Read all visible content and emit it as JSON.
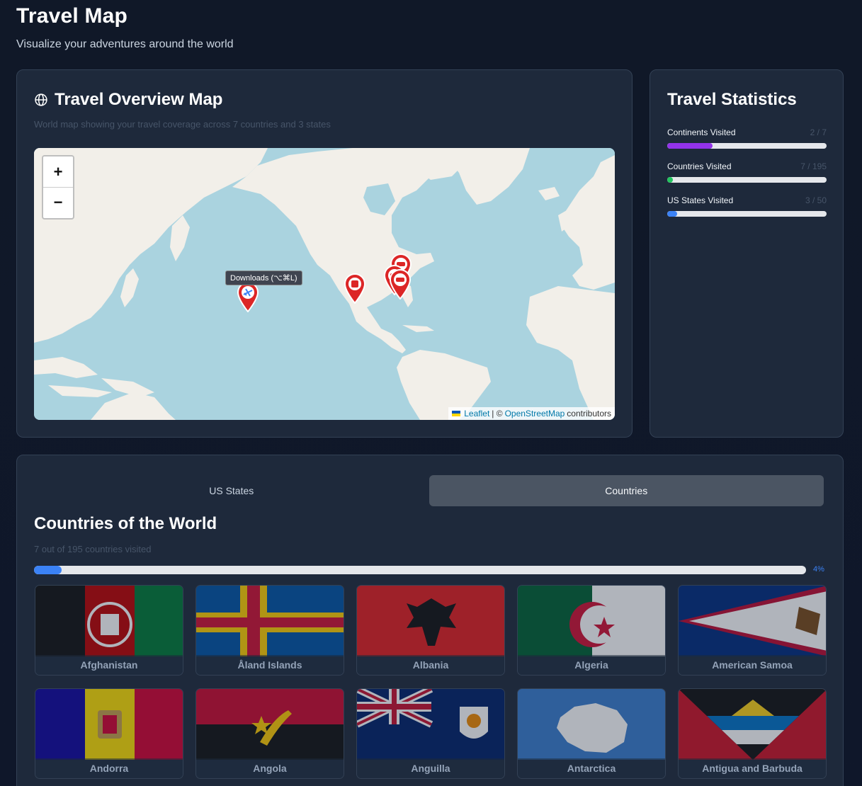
{
  "page": {
    "title": "Travel Map",
    "subtitle": "Visualize your adventures around the world"
  },
  "map_card": {
    "title": "Travel Overview Map",
    "title_icon": "globe-icon",
    "description": "World map showing your travel coverage across 7 countries and 3 states",
    "zoom_in_label": "+",
    "zoom_out_label": "−",
    "tooltip": "Downloads (⌥⌘L)",
    "attribution": {
      "leaflet": "Leaflet",
      "separator": "| ©",
      "osm": "OpenStreetMap",
      "suffix": "contributors"
    },
    "markers": [
      {
        "name": "hawaii",
        "icon": "plane-icon"
      },
      {
        "name": "mexico",
        "icon": "train-icon"
      },
      {
        "name": "us-east-1",
        "icon": "car-icon"
      },
      {
        "name": "us-east-2",
        "icon": "car-icon"
      },
      {
        "name": "us-east-3",
        "icon": "car-icon"
      }
    ],
    "colors": {
      "marker": "#dc2626",
      "water": "#aad3df",
      "land": "#f2efe9"
    }
  },
  "stats_card": {
    "title": "Travel Statistics",
    "items": [
      {
        "label": "Continents Visited",
        "count": "2 / 7",
        "fraction": 0.2857,
        "color": "#9333ea"
      },
      {
        "label": "Countries Visited",
        "count": "7 / 195",
        "fraction": 0.0359,
        "color": "#22c55e"
      },
      {
        "label": "US States Visited",
        "count": "3 / 50",
        "fraction": 0.06,
        "color": "#3b82f6"
      }
    ]
  },
  "list_card": {
    "tabs": [
      {
        "label": "US States",
        "active": false
      },
      {
        "label": "Countries",
        "active": true
      }
    ],
    "title": "Countries of the World",
    "subtitle": "7 out of 195 countries visited",
    "progress_percent": 4,
    "progress_label": "4%",
    "countries": [
      {
        "name": "Afghanistan"
      },
      {
        "name": "Åland Islands"
      },
      {
        "name": "Albania"
      },
      {
        "name": "Algeria"
      },
      {
        "name": "American Samoa"
      },
      {
        "name": "Andorra"
      },
      {
        "name": "Angola"
      },
      {
        "name": "Anguilla"
      },
      {
        "name": "Antarctica"
      },
      {
        "name": "Antigua and Barbuda"
      }
    ]
  }
}
